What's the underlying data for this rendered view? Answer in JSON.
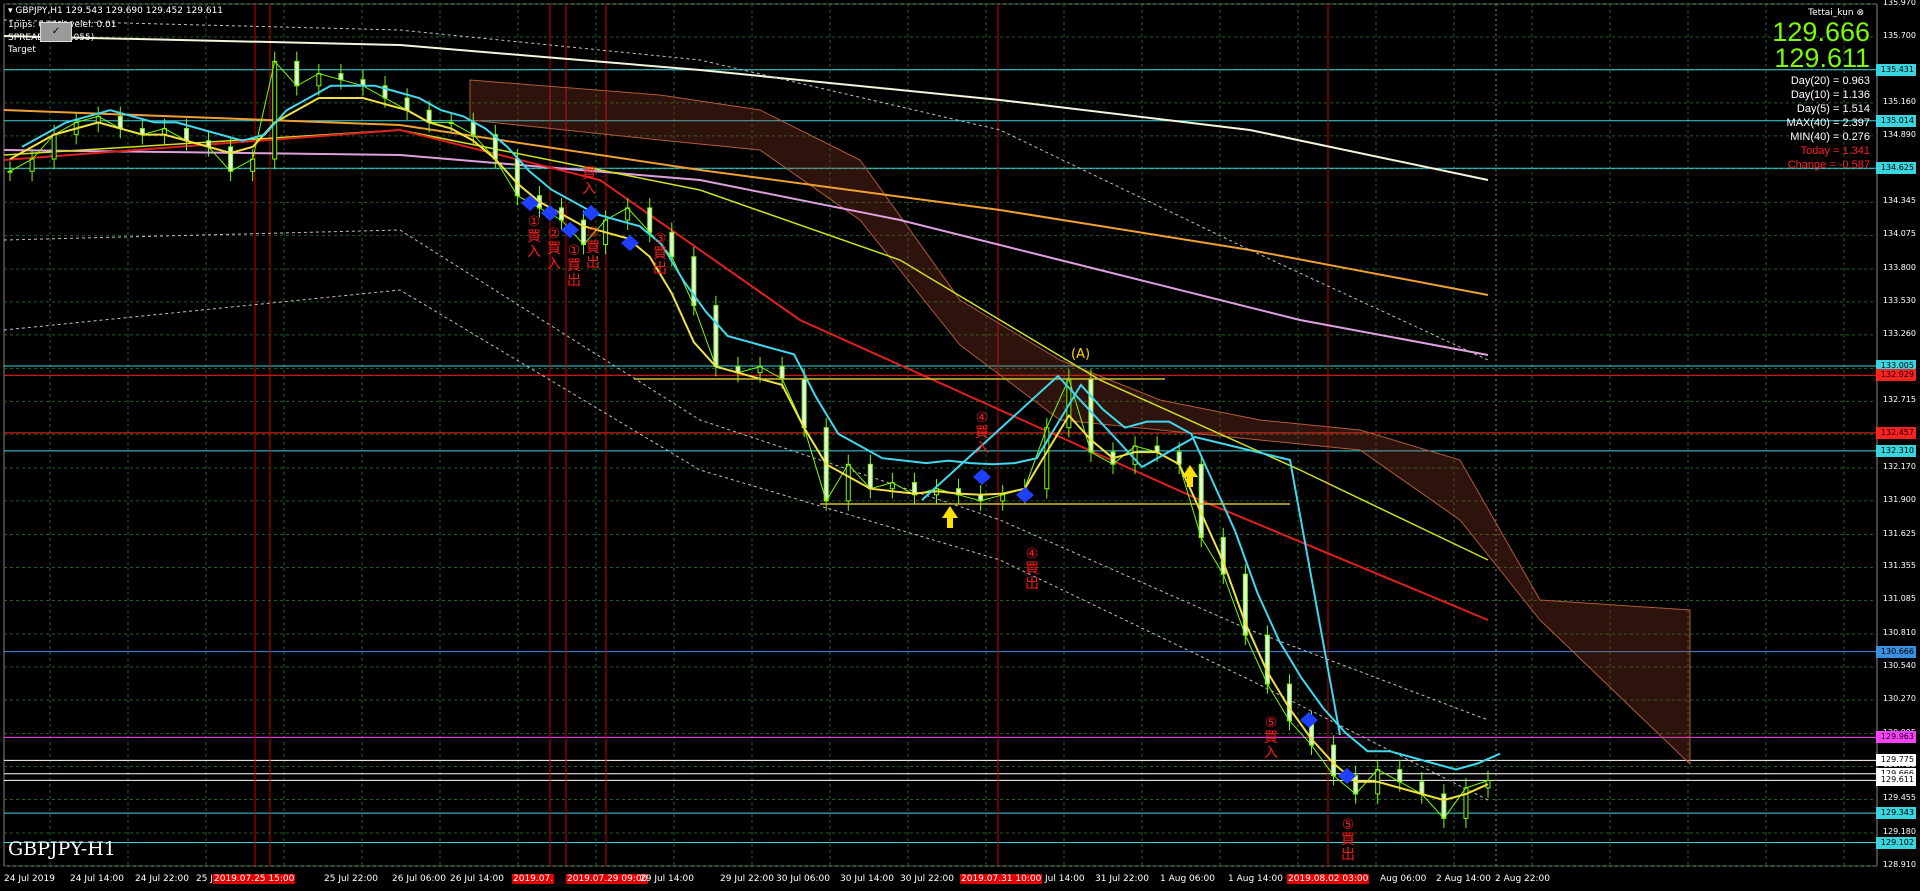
{
  "header": {
    "symbol_line": "GBPJPY,H1  129.543 129.690 129.452 129.611",
    "pips_line": "1pips: 0.01  levelel: 0.01",
    "spread_line": "SPREAD: ... (0.055)",
    "target_line": "Target"
  },
  "close_box_label": "✓",
  "symbol_label": "GBPJPY-H1",
  "indicator": {
    "user": "Tettai_kun",
    "ask": "129.666",
    "bid": "129.611",
    "stats": [
      {
        "text": "Day(20) = 0.963",
        "color": "#ffffff"
      },
      {
        "text": "Day(10) = 1.136",
        "color": "#ffffff"
      },
      {
        "text": "Day(5) = 1.514",
        "color": "#ffffff"
      },
      {
        "text": "MAX(40) = 2.397",
        "color": "#ffffff"
      },
      {
        "text": "MIN(40) = 0.276",
        "color": "#ffffff"
      },
      {
        "text": "Today = 1.341",
        "color": "#ff2020"
      },
      {
        "text": "Change = -0.587",
        "color": "#ff2020"
      }
    ]
  },
  "price_axis": {
    "ticks": [
      "135.970",
      "135.700",
      "135.431",
      "135.160",
      "134.890",
      "134.620",
      "134.345",
      "134.075",
      "133.800",
      "133.530",
      "133.260",
      "132.985",
      "132.715",
      "132.445",
      "132.170",
      "131.900",
      "131.625",
      "131.355",
      "131.085",
      "130.810",
      "130.540",
      "130.270",
      "129.995",
      "129.725",
      "129.455",
      "129.180",
      "128.910"
    ],
    "tags": [
      {
        "price": "135.431",
        "value": 135.431,
        "color": "#3ad6e0"
      },
      {
        "price": "135.014",
        "value": 135.014,
        "color": "#3ad6e0"
      },
      {
        "price": "134.625",
        "value": 134.625,
        "color": "#3ad6e0"
      },
      {
        "price": "133.005",
        "value": 133.005,
        "color": "#3ad6e0"
      },
      {
        "price": "132.929",
        "value": 132.929,
        "color": "#ff2020"
      },
      {
        "price": "132.457",
        "value": 132.457,
        "color": "#ff2020"
      },
      {
        "price": "132.310",
        "value": 132.31,
        "color": "#3ad6e0"
      },
      {
        "price": "130.666",
        "value": 130.666,
        "color": "#3a8fe0"
      },
      {
        "price": "129.963",
        "value": 129.963,
        "color": "#ff40ff"
      },
      {
        "price": "129.775",
        "value": 129.775,
        "color": "#ffffff"
      },
      {
        "price": "129.666",
        "value": 129.666,
        "color": "#ffffff"
      },
      {
        "price": "129.611",
        "value": 129.611,
        "color": "#ffffff"
      },
      {
        "price": "129.343",
        "value": 129.343,
        "color": "#3ad6e0"
      },
      {
        "price": "129.102",
        "value": 129.102,
        "color": "#3ad6e0"
      }
    ]
  },
  "time_axis": [
    {
      "text": "24 Jul 2019",
      "red": false
    },
    {
      "text": "24 Jul 14:00",
      "red": false
    },
    {
      "text": "24 Jul 22:00",
      "red": false
    },
    {
      "text": "25 J",
      "red": false
    },
    {
      "text": "2019.07.25 15:00",
      "red": true
    },
    {
      "text": "25 Jul 22:00",
      "red": false
    },
    {
      "text": "26 Jul 06:00",
      "red": false
    },
    {
      "text": "26 Jul 14:00",
      "red": false
    },
    {
      "text": "2019.07.",
      "red": true
    },
    {
      "text": "2019.07.29 09:00",
      "red": true
    },
    {
      "text": "29 Jul 14:00",
      "red": false
    },
    {
      "text": "29 Jul 22:00",
      "red": false
    },
    {
      "text": "30 Jul 06:00",
      "red": false
    },
    {
      "text": "30 Jul 14:00",
      "red": false
    },
    {
      "text": "30 Jul 22:00",
      "red": false
    },
    {
      "text": "2019.07.31 10:00",
      "red": true
    },
    {
      "text": "Jul 14:00",
      "red": false
    },
    {
      "text": "31 Jul 22:00",
      "red": false
    },
    {
      "text": "1 Aug 06:00",
      "red": false
    },
    {
      "text": "1 Aug 14:00",
      "red": false
    },
    {
      "text": "2019.08.02 03:00",
      "red": true
    },
    {
      "text": "Aug 06:00",
      "red": false
    },
    {
      "text": "2 Aug 14:00",
      "red": false
    },
    {
      "text": "2 Aug 22:00",
      "red": false
    }
  ],
  "annotations": [
    {
      "text": "①\n買\n入",
      "color": "#ff1a1a"
    },
    {
      "text": "②\n買\n入",
      "color": "#ff1a1a"
    },
    {
      "text": "①\n買\n出",
      "color": "#ff1a1a"
    },
    {
      "text": "②\n買\n出",
      "color": "#ff1a1a"
    },
    {
      "text": "買\n入",
      "color": "#ff1a1a"
    },
    {
      "text": "③\n買\n出",
      "color": "#ff1a1a"
    },
    {
      "text": "④\n買\n入",
      "color": "#ff1a1a"
    },
    {
      "text": "④\n買\n出",
      "color": "#ff1a1a"
    },
    {
      "text": "⑤\n買\n入",
      "color": "#ff1a1a"
    },
    {
      "text": "⑤\n買\n出",
      "color": "#ff1a1a"
    }
  ],
  "label_a": "(A)",
  "chart_data": {
    "type": "candlestick",
    "symbol": "GBPJPY",
    "timeframe": "H1",
    "last_ohlc": {
      "open": 129.543,
      "high": 129.69,
      "low": 129.452,
      "close": 129.611
    },
    "y_range": [
      128.91,
      135.97
    ],
    "close_path": [
      134.6,
      134.7,
      134.9,
      135.0,
      135.05,
      134.95,
      134.9,
      134.95,
      134.85,
      134.8,
      134.6,
      134.7,
      135.5,
      135.3,
      135.4,
      135.35,
      135.3,
      135.2,
      135.1,
      135.0,
      135.0,
      134.9,
      134.7,
      134.4,
      134.3,
      134.2,
      134.0,
      134.2,
      134.3,
      134.1,
      133.9,
      133.5,
      133.0,
      132.95,
      133.0,
      132.9,
      132.5,
      131.9,
      132.2,
      132.0,
      132.05,
      131.95,
      132.0,
      131.95,
      131.9,
      131.95,
      132.0,
      132.5,
      132.9,
      132.3,
      132.2,
      132.35,
      132.3,
      132.2,
      131.6,
      131.3,
      130.8,
      130.4,
      130.1,
      129.9,
      129.65,
      129.5,
      129.7,
      129.6,
      129.5,
      129.3,
      129.55,
      129.61
    ],
    "ema_fast": [
      134.7,
      134.8,
      134.9,
      134.95,
      135.0,
      134.95,
      134.9,
      134.9,
      134.85,
      134.8,
      134.75,
      134.8,
      135.0,
      135.1,
      135.2,
      135.2,
      135.2,
      135.15,
      135.1,
      135.0,
      134.95,
      134.85,
      134.7,
      134.5,
      134.35,
      134.25,
      134.15,
      134.1,
      134.05,
      133.9,
      133.6,
      133.2,
      133.0,
      132.95,
      132.9,
      132.85,
      132.5,
      132.2,
      132.1,
      132.0,
      131.98,
      131.96,
      131.98,
      131.96,
      131.95,
      131.96,
      132.0,
      132.3,
      132.6,
      132.4,
      132.25,
      132.3,
      132.3,
      132.2,
      131.8,
      131.4,
      130.9,
      130.5,
      130.2,
      129.95,
      129.75,
      129.6,
      129.6,
      129.55,
      129.5,
      129.45,
      129.5,
      129.58
    ]
  }
}
